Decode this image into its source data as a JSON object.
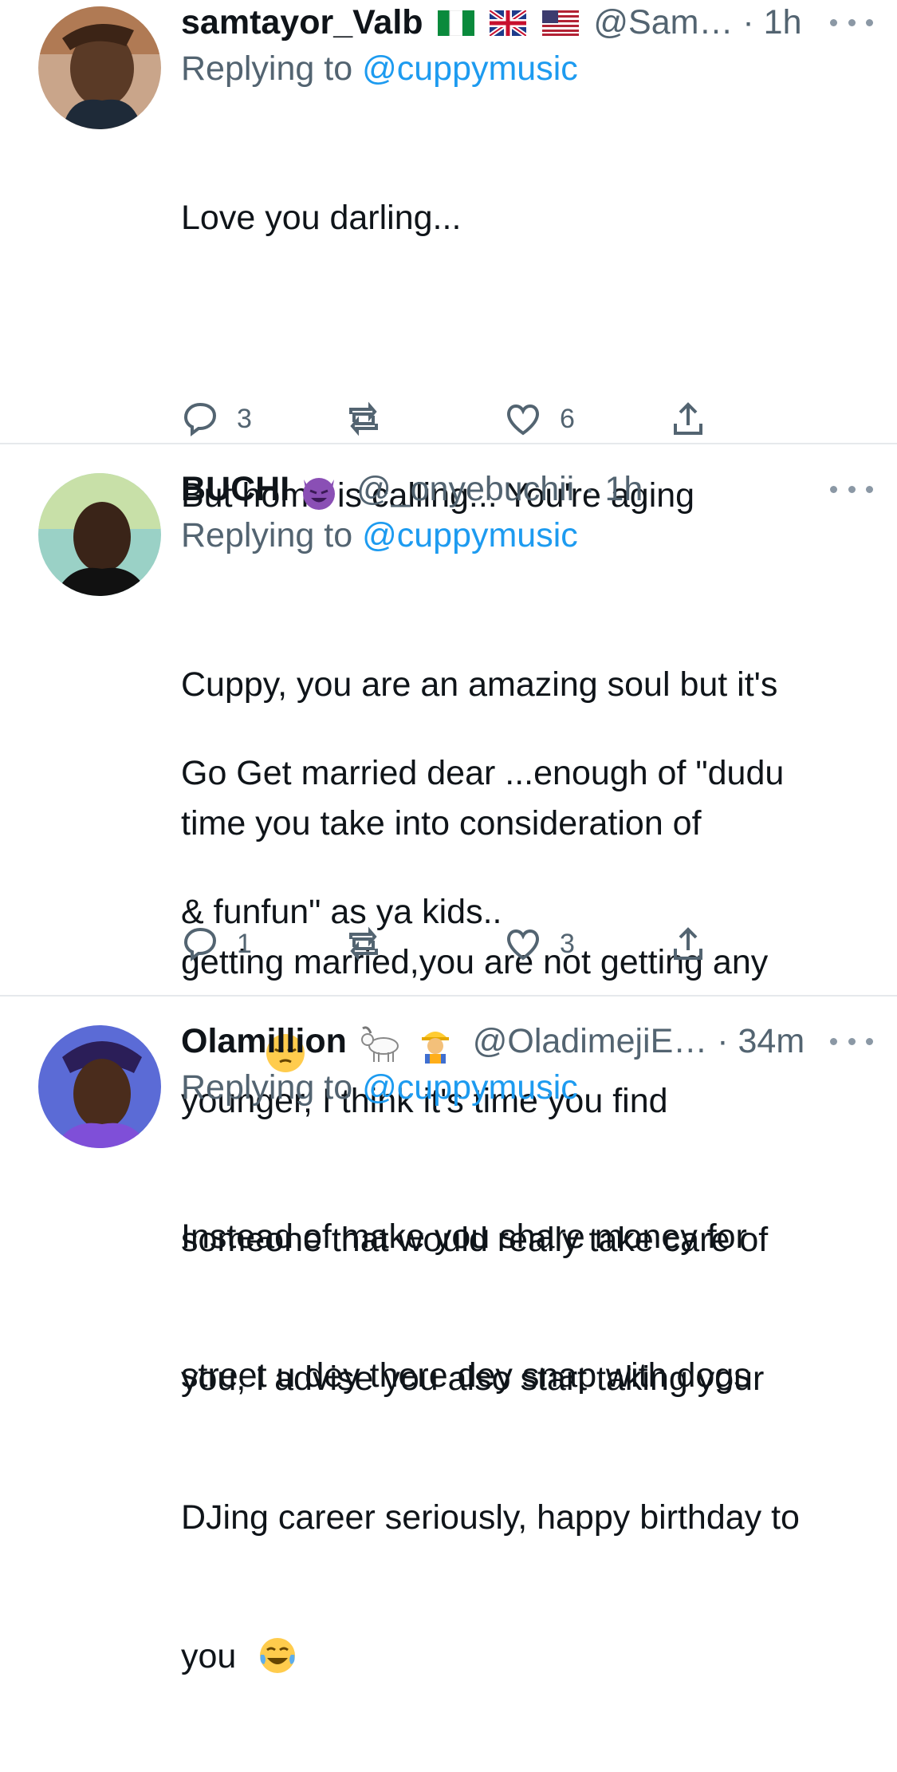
{
  "tweets": [
    {
      "display_name": "samtayor_Valb",
      "handle": "@Sam…",
      "time": "1h",
      "replying_label": "Replying to",
      "replying_to": "@cuppymusic",
      "body_lines": [
        "Love you darling...",
        "",
        "But home is calling... You're aging",
        "",
        "Go Get married dear ...enough of \"dudu",
        "& funfun\" as ya kids.."
      ],
      "replies": "3",
      "retweets": "",
      "likes": "6"
    },
    {
      "display_name": "BUCHI",
      "handle": "@_onyebuchii",
      "time": "1h",
      "replying_label": "Replying to",
      "replying_to": "@cuppymusic",
      "body_lines": [
        "Cuppy, you are an amazing soul but it's",
        "time you take into consideration of",
        "getting married,you are not getting any",
        "younger, I think it's time you find",
        "someone that would really take care of",
        "you, I advise you also start taking your",
        "DJing career seriously, happy birthday to",
        "you"
      ],
      "replies": "1",
      "retweets": "",
      "likes": "3"
    },
    {
      "display_name": "Olamillion",
      "handle": "@OladimejiE…",
      "time": "34m",
      "replying_label": "Replying to",
      "replying_to": "@cuppymusic",
      "body_lines": [
        "Instead of make you share money for",
        "street u dey there dey snap with dogs"
      ]
    }
  ],
  "icons": {
    "flags": [
      "nigeria-flag-icon",
      "uk-flag-icon",
      "us-flag-icon"
    ],
    "emoji_1": "pensive-face-emoji",
    "emoji_2": "smiling-devil-emoji",
    "emoji_3": [
      "goat-emoji",
      "construction-worker-emoji",
      "tears-of-joy-emoji"
    ]
  },
  "colors": {
    "link": "#1d9bf0",
    "secondary": "#536471",
    "text": "#0f1419"
  }
}
